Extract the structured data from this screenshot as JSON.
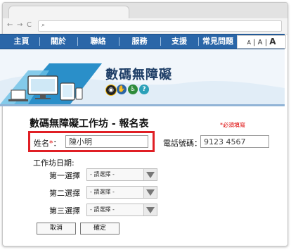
{
  "browser": {
    "url": "",
    "nav": {
      "back": "←",
      "forward": "→",
      "reload": "C"
    }
  },
  "menu": {
    "items": [
      "主頁",
      "關於",
      "聯絡",
      "服務",
      "支援",
      "常見問題"
    ],
    "font_size": {
      "small": "A",
      "medium": "A",
      "large": "A"
    }
  },
  "site": {
    "title": "數碼無障礙"
  },
  "form": {
    "title": "數碼無障礙工作坊 - 報名表",
    "required_note": "*必須填寫",
    "name_label": "姓名",
    "name_required_mark": "*",
    "name_colon": "：",
    "name_value": "陳小明",
    "phone_label": "電話號碼：",
    "phone_value": "9123 4567",
    "date_label": "工作坊日期:",
    "choices": [
      {
        "label": "第一選擇",
        "selected": "- 請選擇 -"
      },
      {
        "label": "第二選擇",
        "selected": "- 請選擇 -"
      },
      {
        "label": "第三選擇",
        "selected": "- 請選擇 -"
      }
    ],
    "cancel_label": "取消",
    "confirm_label": "確定"
  },
  "colors": {
    "menu_bg": "#2a66a8",
    "highlight_border": "#e01f25",
    "required_text": "#dd0000",
    "title_text": "#1d3d66"
  }
}
